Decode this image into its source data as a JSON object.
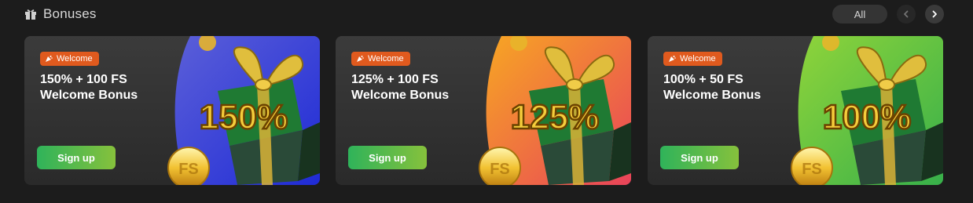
{
  "header": {
    "title": "Bonuses",
    "all_label": "All",
    "icons": {
      "section": "gift-icon",
      "prev": "chevron-left-icon",
      "next": "chevron-right-icon"
    }
  },
  "cards": [
    {
      "badge": "Welcome",
      "title_line1": "150% + 100 FS",
      "title_line2": "Welcome Bonus",
      "art_percent": "150%",
      "art_coin": "FS",
      "cta": "Sign up",
      "bg_color_a": "#5b5fd8",
      "bg_color_b": "#1f2bd6"
    },
    {
      "badge": "Welcome",
      "title_line1": "125% + 100 FS",
      "title_line2": "Welcome Bonus",
      "art_percent": "125%",
      "art_coin": "FS",
      "cta": "Sign up",
      "bg_color_a": "#f7a623",
      "bg_color_b": "#e8435a"
    },
    {
      "badge": "Welcome",
      "title_line1": "100% + 50 FS",
      "title_line2": "Welcome Bonus",
      "art_percent": "100%",
      "art_coin": "FS",
      "cta": "Sign up",
      "bg_color_a": "#8fd43a",
      "bg_color_b": "#37b04a"
    }
  ],
  "colors": {
    "page_bg": "#1c1c1c",
    "badge": "#e05a1e",
    "cta_start": "#2fb35a",
    "cta_end": "#86c13c"
  }
}
